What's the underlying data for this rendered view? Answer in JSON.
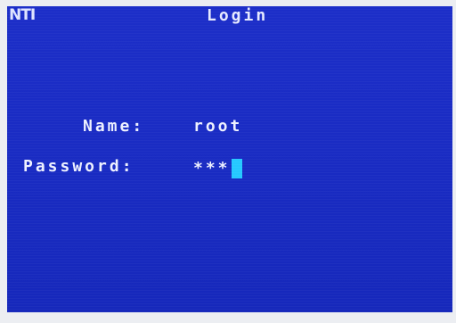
{
  "header": {
    "logo_text": "NTI",
    "title": "Login"
  },
  "form": {
    "name_label": "Name:",
    "name_value": "root",
    "password_label": "Password:",
    "password_value": "***"
  },
  "colors": {
    "screen_background": "#1a2cc4",
    "text": "#eef1ff",
    "cursor": "#25c8ff"
  }
}
